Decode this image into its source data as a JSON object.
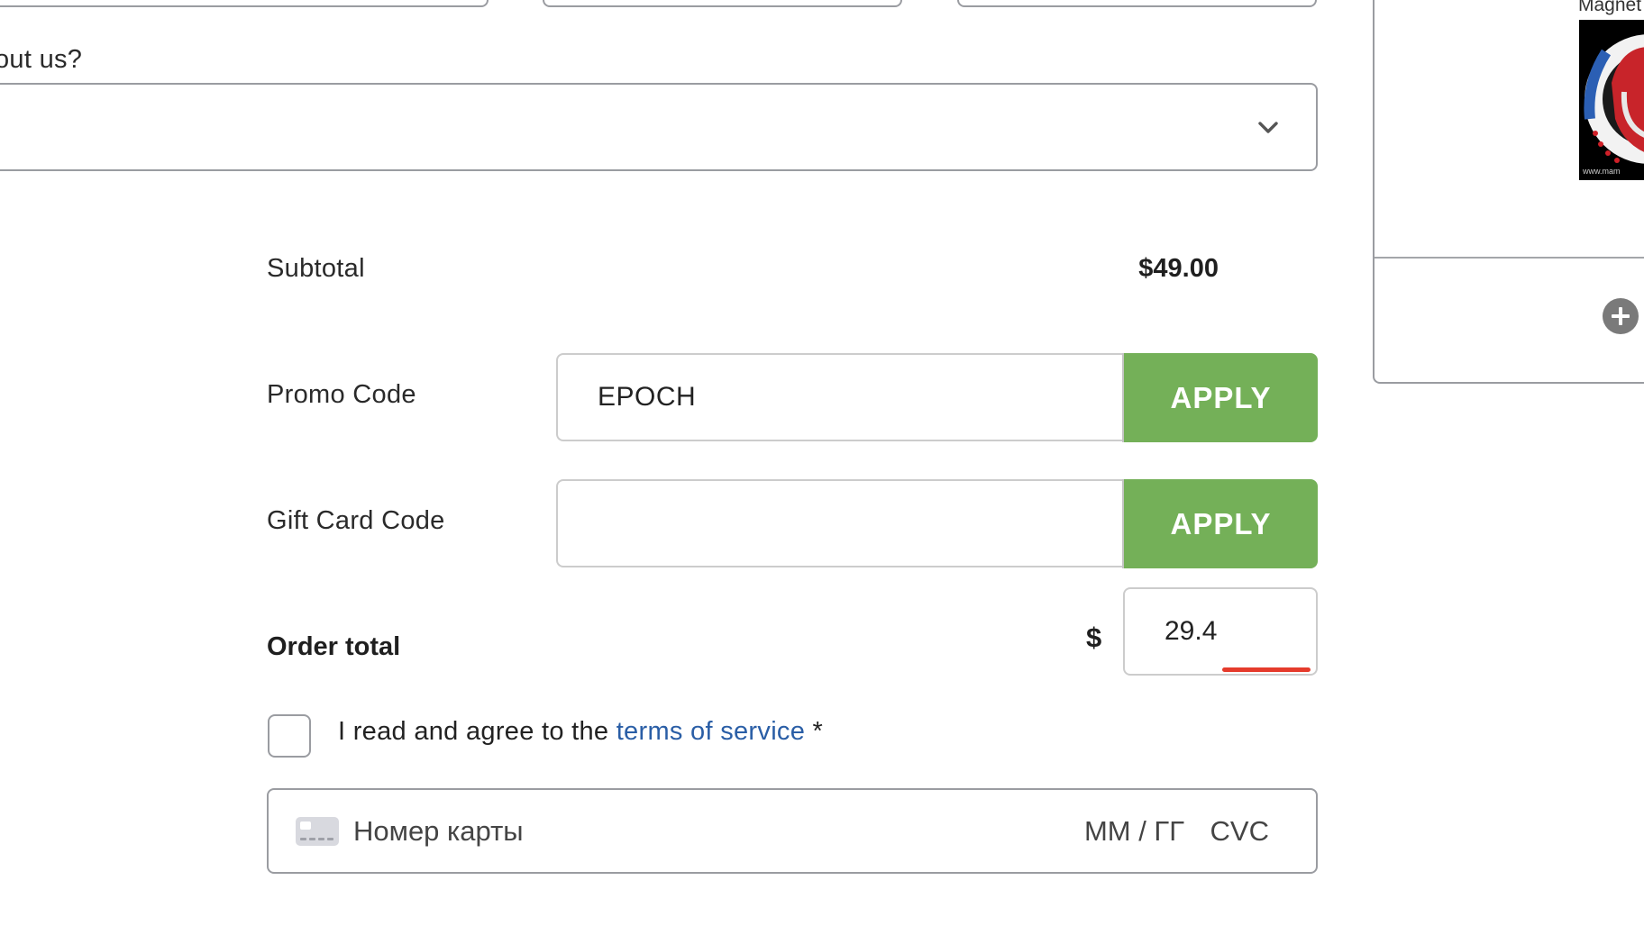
{
  "referral": {
    "label": "out us?",
    "selected_value": ""
  },
  "summary": {
    "subtotal_label": "Subtotal",
    "subtotal_value": "$49.00",
    "promo_label": "Promo Code",
    "promo_value": "EPOCH",
    "promo_apply": "APPLY",
    "gift_label": "Gift Card Code",
    "gift_value": "",
    "gift_apply": "APPLY",
    "order_total_label": "Order total",
    "currency_symbol": "$",
    "order_total_value": "29.4"
  },
  "terms": {
    "prefix": "I read and agree to the ",
    "link": "terms of service",
    "suffix": " *",
    "checked": false
  },
  "card": {
    "number_placeholder": "Номер карты",
    "expiry_placeholder": "ММ / ГГ",
    "cvc_placeholder": "CVC"
  },
  "cart_panel": {
    "product_name": "Magnet",
    "thumb_caption": "www.mam"
  },
  "colors": {
    "apply_green": "#74b058",
    "link_blue": "#2a5ea6",
    "error_red": "#e53b2c"
  }
}
